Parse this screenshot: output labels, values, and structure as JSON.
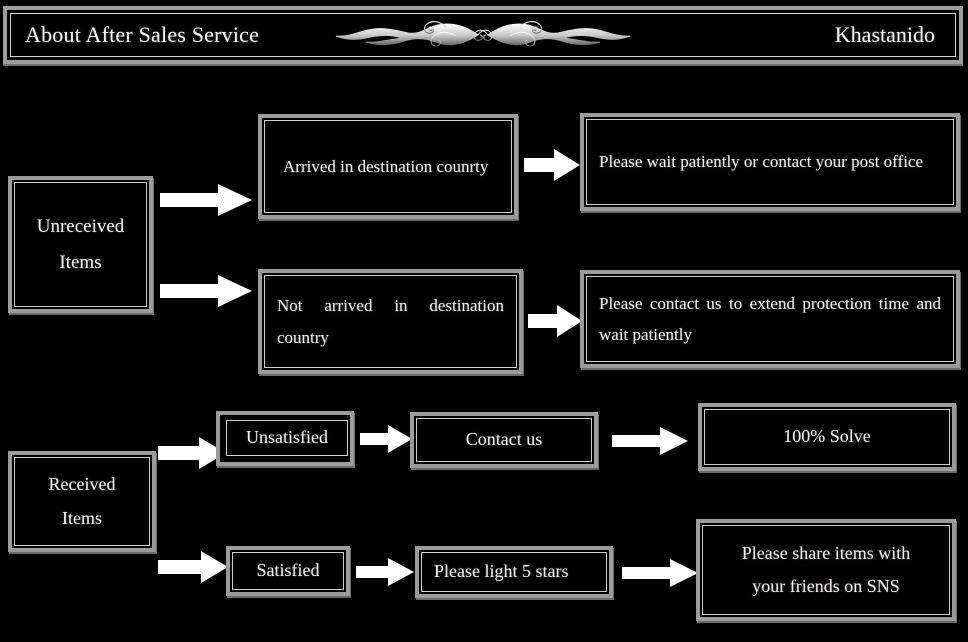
{
  "header": {
    "title": "About After Sales Service",
    "brand": "Khastanido",
    "ornament_icon": "flourish-ornament-icon"
  },
  "colors": {
    "background": "#000000",
    "text": "#f4f2f0",
    "box_border_outer": "#9b9b9b",
    "box_border_inner": "#cfcdcb",
    "arrow_fill": "#ffffff"
  },
  "flow": {
    "branches": [
      {
        "id": "unreceived",
        "root": "Unreceived\nItems",
        "root_line1": "Unreceived",
        "root_line2": "Items",
        "paths": [
          {
            "condition": "Arrived in destination counrty",
            "action": "Please wait patiently or contact your post office"
          },
          {
            "condition": "Not arrived in destination country",
            "action": "Please contact us to extend protection time and wait patiently"
          }
        ]
      },
      {
        "id": "received",
        "root": "Received\nItems",
        "root_line1": "Received",
        "root_line2": "Items",
        "paths": [
          {
            "condition": "Unsatisfied",
            "step": "Contact us",
            "outcome": "100% Solve"
          },
          {
            "condition": "Satisfied",
            "step": "Please light 5 stars",
            "outcome_line1": "Please share items with",
            "outcome_line2": "your friends on SNS",
            "outcome": "Please share items with your friends on SNS"
          }
        ]
      }
    ]
  },
  "arrows": {
    "icon": "right-block-arrow-icon",
    "labels": [
      "arrow-unreceived-to-arrived",
      "arrow-unreceived-to-not-arrived",
      "arrow-arrived-to-wait",
      "arrow-not-arrived-to-contact",
      "arrow-received-to-unsatisfied",
      "arrow-received-to-satisfied",
      "arrow-unsatisfied-to-contact-us",
      "arrow-contact-us-to-solve",
      "arrow-satisfied-to-light-stars",
      "arrow-light-stars-to-share"
    ]
  }
}
